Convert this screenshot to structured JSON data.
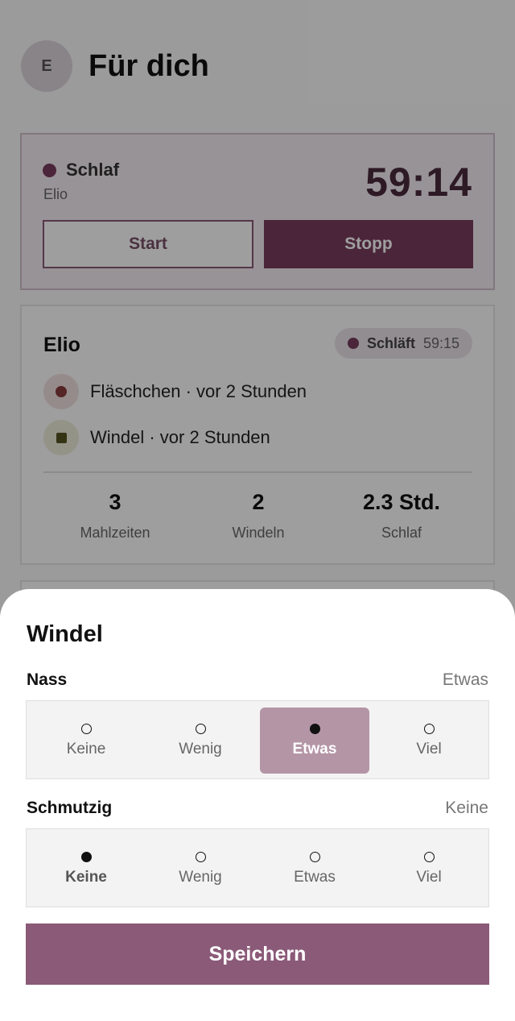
{
  "header": {
    "avatar_initial": "E",
    "title": "Für dich"
  },
  "timer_card": {
    "label": "Schlaf",
    "child": "Elio",
    "time": "59:14",
    "start_label": "Start",
    "stop_label": "Stopp",
    "accent_color": "#7a3c5e"
  },
  "child_card": {
    "name": "Elio",
    "status_label": "Schläft",
    "status_time": "59:15",
    "events": [
      {
        "text": "Fläschchen · vor 2 Stunden",
        "icon": "bottle-icon"
      },
      {
        "text": "Windel · vor 2 Stunden",
        "icon": "diaper-icon"
      }
    ],
    "stats": [
      {
        "value": "3",
        "label": "Mahlzeiten"
      },
      {
        "value": "2",
        "label": "Windeln"
      },
      {
        "value": "2.3 Std.",
        "label": "Schlaf"
      }
    ]
  },
  "sheet": {
    "title": "Windel",
    "nass": {
      "label": "Nass",
      "value": "Etwas",
      "options": [
        "Keine",
        "Wenig",
        "Etwas",
        "Viel"
      ],
      "selected_index": 2
    },
    "schmutzig": {
      "label": "Schmutzig",
      "value": "Keine",
      "options": [
        "Keine",
        "Wenig",
        "Etwas",
        "Viel"
      ],
      "selected_index": 0
    },
    "save_label": "Speichern",
    "button_color": "#8a5a78"
  }
}
